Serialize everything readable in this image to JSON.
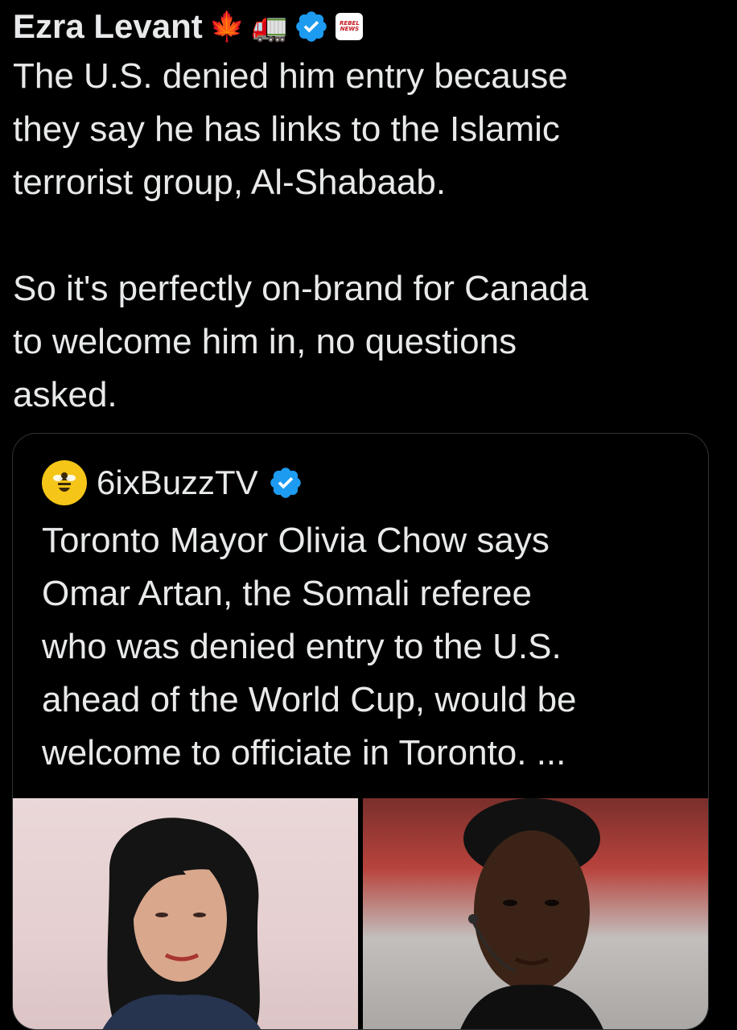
{
  "post": {
    "author": "Ezra Levant",
    "author_emojis": [
      "🍁",
      "🚛"
    ],
    "verified_icon": "verified-badge-icon",
    "org_badge": {
      "line1": "REBEL",
      "line2": "NEWS"
    },
    "text": "The U.S. denied him entry because\nthey say he has links to the Islamic\nterrorist group, Al-Shabaab.\n\nSo it's perfectly on-brand for Canada\nto welcome him in, no questions\nasked."
  },
  "quoted": {
    "author": "6ixBuzzTV",
    "avatar_icon": "bee-icon",
    "verified_icon": "verified-badge-icon",
    "text": "Toronto Mayor Olivia Chow says\nOmar Artan, the Somali referee\nwho was denied entry to the U.S.\nahead of the World Cup, would be\nwelcome to officiate in Toronto. ...",
    "media": [
      {
        "name": "woman-portrait-photo",
        "description_icon": "photo"
      },
      {
        "name": "man-portrait-photo",
        "description_icon": "photo"
      }
    ]
  },
  "colors": {
    "background": "#000000",
    "text": "#e7e9ea",
    "verified_blue": "#1d9bf0",
    "card_border": "#2f3336",
    "avatar_yellow": "#f5c518"
  }
}
